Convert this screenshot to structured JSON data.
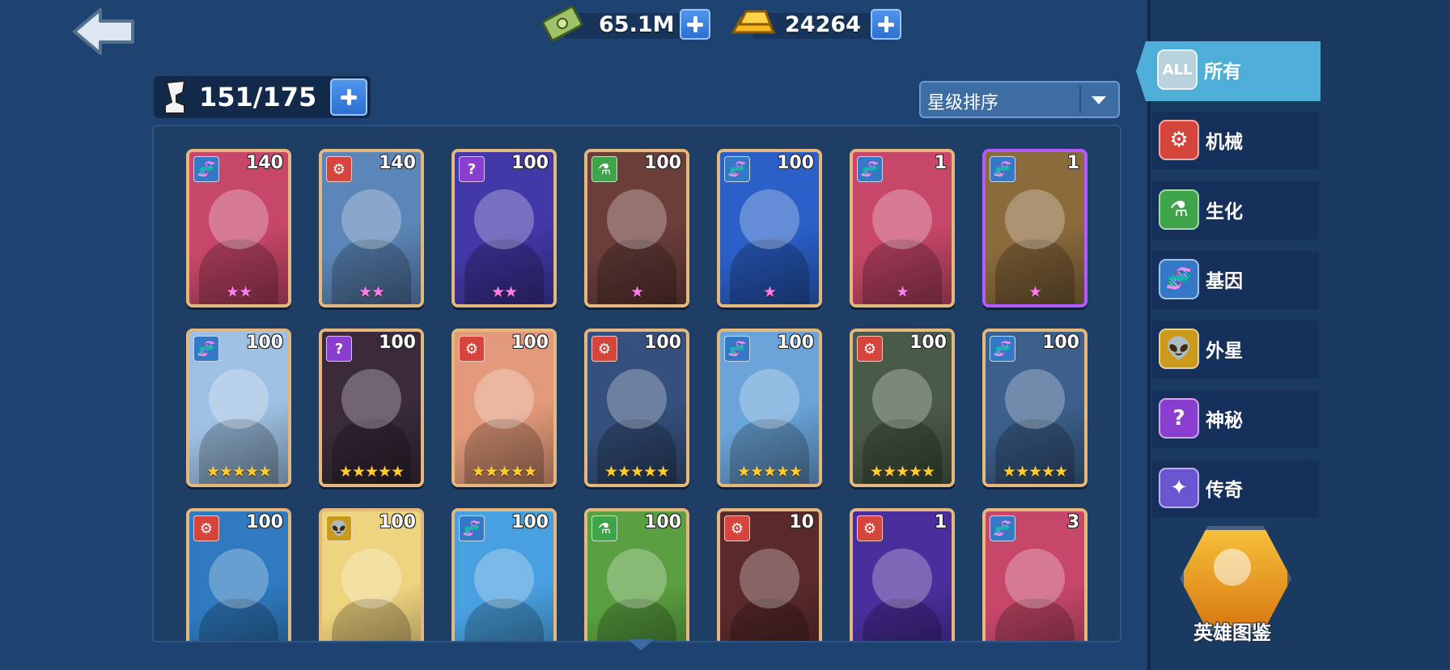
{
  "currency": {
    "cash": "65.1M",
    "gold": "24264"
  },
  "roster": {
    "capacity": "151/175"
  },
  "sort": {
    "label": "星级排序"
  },
  "categories": [
    {
      "icon_text": "ALL",
      "label": "所有",
      "icon": "all-icon",
      "color": "#b9d3de"
    },
    {
      "icon_text": "⚙",
      "label": "机械",
      "icon": "mech-icon",
      "color": "#d6453b"
    },
    {
      "icon_text": "⚗",
      "label": "生化",
      "icon": "bio-flask-icon",
      "color": "#3da44a"
    },
    {
      "icon_text": "🧬",
      "label": "基因",
      "icon": "dna-icon",
      "color": "#3579c6"
    },
    {
      "icon_text": "👽",
      "label": "外星",
      "icon": "alien-icon",
      "color": "#c99a1c"
    },
    {
      "icon_text": "?",
      "label": "神秘",
      "icon": "mystery-icon",
      "color": "#8a3ed0"
    },
    {
      "icon_text": "✦",
      "label": "传奇",
      "icon": "legend-icon",
      "color": "#6a55d0"
    }
  ],
  "encyclopedia": {
    "label": "英雄图鉴"
  },
  "heroes": [
    {
      "type": "gene",
      "level": "140",
      "stars": "★★",
      "star_color": "pink",
      "bg": "#c7476a"
    },
    {
      "type": "mech",
      "level": "140",
      "stars": "★★",
      "star_color": "pink",
      "bg": "#5c86b8"
    },
    {
      "type": "myst",
      "level": "100",
      "stars": "★★",
      "star_color": "pink",
      "bg": "#4338a8"
    },
    {
      "type": "bio",
      "level": "100",
      "stars": "★",
      "star_color": "pink",
      "bg": "#6b3e3a"
    },
    {
      "type": "gene",
      "level": "100",
      "stars": "★",
      "star_color": "pink",
      "bg": "#2a60c8"
    },
    {
      "type": "gene",
      "level": "1",
      "stars": "★",
      "star_color": "pink",
      "bg": "#c7476a"
    },
    {
      "type": "gene",
      "level": "1",
      "stars": "★",
      "star_color": "pink",
      "bg": "#8b6a3c",
      "frame": "purple"
    },
    {
      "type": "gene",
      "level": "100",
      "stars": "★★★★★",
      "star_color": "gold",
      "bg": "#9ec0e2"
    },
    {
      "type": "myst",
      "level": "100",
      "stars": "★★★★★",
      "star_color": "gold",
      "bg": "#3a2a3a"
    },
    {
      "type": "mech",
      "level": "100",
      "stars": "★★★★★",
      "star_color": "gold",
      "bg": "#e39a7a"
    },
    {
      "type": "mech",
      "level": "100",
      "stars": "★★★★★",
      "star_color": "gold",
      "bg": "#35507c"
    },
    {
      "type": "gene",
      "level": "100",
      "stars": "★★★★★",
      "star_color": "gold",
      "bg": "#6aa4d8"
    },
    {
      "type": "mech",
      "level": "100",
      "stars": "★★★★★",
      "star_color": "gold",
      "bg": "#4a5a48"
    },
    {
      "type": "gene",
      "level": "100",
      "stars": "★★★★★",
      "star_color": "gold",
      "bg": "#3c5f8c"
    },
    {
      "type": "mech",
      "level": "100",
      "stars": "",
      "star_color": "gold",
      "bg": "#2f7ac0"
    },
    {
      "type": "alien",
      "level": "100",
      "stars": "",
      "star_color": "gold",
      "bg": "#efd480"
    },
    {
      "type": "gene",
      "level": "100",
      "stars": "",
      "star_color": "gold",
      "bg": "#48a0e0"
    },
    {
      "type": "bio",
      "level": "100",
      "stars": "",
      "star_color": "gold",
      "bg": "#5aa040"
    },
    {
      "type": "mech",
      "level": "10",
      "stars": "",
      "star_color": "gold",
      "bg": "#5a2a2a"
    },
    {
      "type": "mech",
      "level": "1",
      "stars": "",
      "star_color": "gold",
      "bg": "#4a2e9c"
    },
    {
      "type": "gene",
      "level": "3",
      "stars": "",
      "star_color": "gold",
      "bg": "#c7476a"
    }
  ]
}
